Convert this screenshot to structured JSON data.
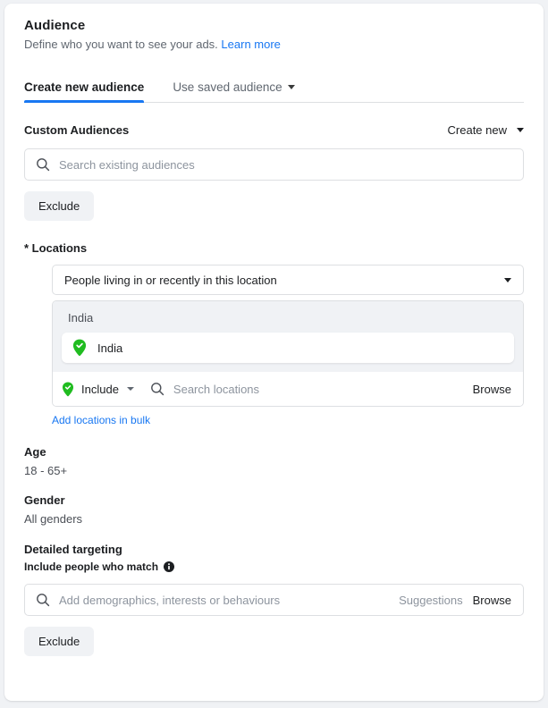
{
  "header": {
    "title": "Audience",
    "subtitle_text": "Define who you want to see your ads.",
    "learn_more": "Learn more"
  },
  "tabs": [
    {
      "label": "Create new audience",
      "active": true,
      "has_caret": false
    },
    {
      "label": "Use saved audience",
      "active": false,
      "has_caret": true
    }
  ],
  "custom_audiences": {
    "label": "Custom Audiences",
    "create_new": "Create new",
    "search_placeholder": "Search existing audiences",
    "exclude_button": "Exclude",
    "search_icon": "search-icon",
    "caret_icon": "chevron-down-icon"
  },
  "locations": {
    "label": "* Locations",
    "selected_option": "People living in or recently in this location",
    "group_title": "India",
    "chips": [
      {
        "label": "India",
        "icon": "location-pin-check-icon"
      }
    ],
    "include_label": "Include",
    "include_icon": "location-pin-check-icon",
    "search_placeholder": "Search locations",
    "browse_label": "Browse",
    "bulk_link": "Add locations in bulk",
    "search_icon": "search-icon",
    "caret_icon": "chevron-down-icon"
  },
  "age": {
    "label": "Age",
    "value": "18 - 65+"
  },
  "gender": {
    "label": "Gender",
    "value": "All genders"
  },
  "detailed_targeting": {
    "label": "Detailed targeting",
    "sub_label": "Include people who match",
    "info_icon": "info-icon",
    "search_placeholder": "Add demographics, interests or behaviours",
    "suggestions_label": "Suggestions",
    "browse_label": "Browse",
    "exclude_button": "Exclude",
    "search_icon": "search-icon"
  },
  "colors": {
    "accent_blue": "#1877f2",
    "pin_green": "#20bc20",
    "text_primary": "#1c1e21",
    "text_secondary": "#606770",
    "placeholder": "#8d949e",
    "border": "#dddfe2",
    "surface_grey": "#f0f2f5"
  }
}
